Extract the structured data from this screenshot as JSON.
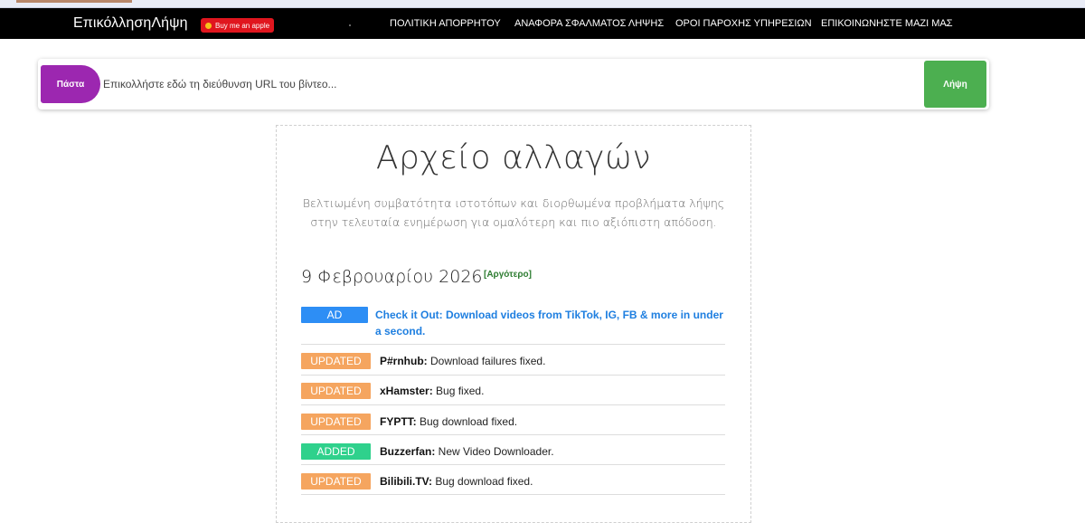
{
  "nav": {
    "brand": "ΕπικόλλησηΛήψη",
    "buy_label": "Buy me an apple",
    "links": [
      "ΠΟΛΙΤΙΚΗ ΑΠΟΡΡΗΤΟΥ",
      "ΑΝΑΦΟΡΑ ΣΦΑΛΜΑΤΟΣ ΛΗΨΗΣ",
      "ΟΡΟΙ ΠΑΡΟΧΗΣ ΥΠΗΡΕΣΙΩΝ",
      "ΕΠΙΚΟΙΝΩΝΗΣΤΕ ΜΑΖΙ ΜΑΣ"
    ]
  },
  "search": {
    "paste_label": "Πάστα",
    "placeholder": "Επικολλήστε εδώ τη διεύθυνση URL του βίντεο...",
    "value": "",
    "download_label": "Λήψη"
  },
  "changelog": {
    "title": "Αρχείο αλλαγών",
    "subtitle": "Βελτιωμένη συμβατότητα ιστοτόπων και διορθωμένα προβλήματα λήψης στην τελευταία ενημέρωση για ομαλότερη και πιο αξιόπιστη απόδοση.",
    "date": "9 Φεβρουαρίου 2026",
    "older_label": "[Αργότερο]",
    "ad": {
      "badge": "AD",
      "text": "Check it Out: Download videos from TikTok, IG, FB & more in under a second."
    },
    "entries": [
      {
        "badge": "UPDATED",
        "site": "P#rnhub:",
        "text": " Download failures fixed."
      },
      {
        "badge": "UPDATED",
        "site": "xHamster:",
        "text": " Bug fixed."
      },
      {
        "badge": "UPDATED",
        "site": "FYPTT:",
        "text": " Bug download fixed."
      },
      {
        "badge": "ADDED",
        "site": "Buzzerfan:",
        "text": " New Video Downloader."
      },
      {
        "badge": "UPDATED",
        "site": "Bilibili.TV:",
        "text": " Bug download fixed."
      }
    ]
  },
  "colors": {
    "nav_bg": "#000000",
    "paste": "#9c27b0",
    "download": "#4caf50",
    "ad": "#2d8ef5",
    "updated": "#f5a55f",
    "added": "#2fd18c",
    "older": "#2e7d32"
  }
}
